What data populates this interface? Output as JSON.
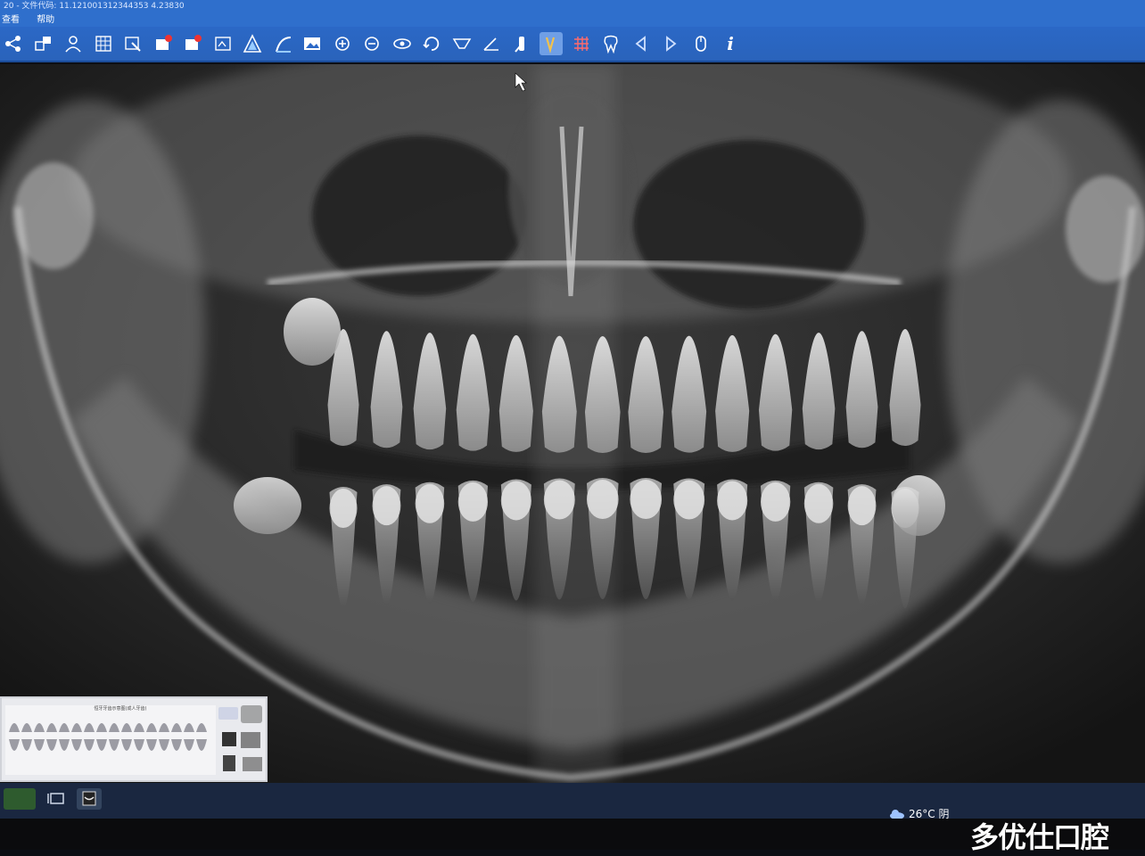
{
  "window": {
    "title": "20 - 文件代码: 11.121001312344353 4.23830"
  },
  "menu": {
    "items": [
      "查看",
      "帮助"
    ]
  },
  "toolbar": {
    "icons": [
      "share-icon",
      "layout-icon",
      "patient-icon",
      "grid-icon",
      "export-icon",
      "delete-image-icon",
      "delete-icon",
      "image-settings-icon",
      "filter-a-icon",
      "filter-b-icon",
      "picture-icon",
      "zoom-in-icon",
      "zoom-out-icon",
      "view-icon",
      "rotate-icon",
      "measure-icon",
      "angle-icon",
      "implant-icon",
      "brush-icon",
      "grid-overlay-icon",
      "tooth-icon",
      "previous-icon",
      "next-icon",
      "mouse-icon",
      "info-icon"
    ],
    "active_index": 18,
    "info_label": "i"
  },
  "thumbnail": {
    "title": "恒牙牙齿示意图(成人牙齿)"
  },
  "taskbar": {
    "weather": "26°C 阴"
  },
  "watermark": "多优仕口腔"
}
